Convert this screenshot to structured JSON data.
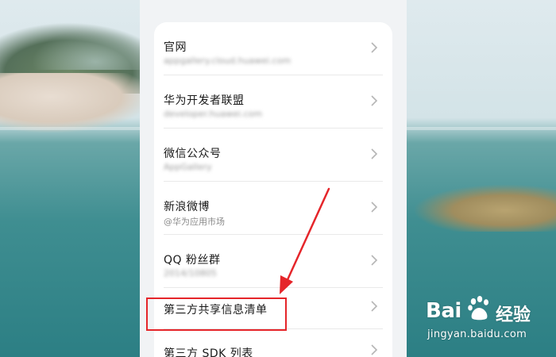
{
  "list": {
    "items": [
      {
        "title": "官网",
        "subtitle": "appgallery.cloud.huawei.com",
        "blurred": true
      },
      {
        "title": "华为开发者联盟",
        "subtitle": "developer.huawei.com",
        "blurred": true
      },
      {
        "title": "微信公众号",
        "subtitle": "AppGallery",
        "blurred": true
      },
      {
        "title": "新浪微博",
        "subtitle": "@华为应用市场",
        "blurred": false
      },
      {
        "title": "QQ 粉丝群",
        "subtitle": "2014/10805",
        "blurred": true
      },
      {
        "title": "第三方共享信息清单",
        "subtitle": "",
        "blurred": false
      },
      {
        "title": "第三方 SDK 列表",
        "subtitle": "",
        "blurred": false
      }
    ]
  },
  "watermark": {
    "brand_left": "Bai",
    "brand_right": "经验",
    "url": "jingyan.baidu.com"
  },
  "colors": {
    "highlight": "#e5252a",
    "arrow": "#e5252a"
  }
}
